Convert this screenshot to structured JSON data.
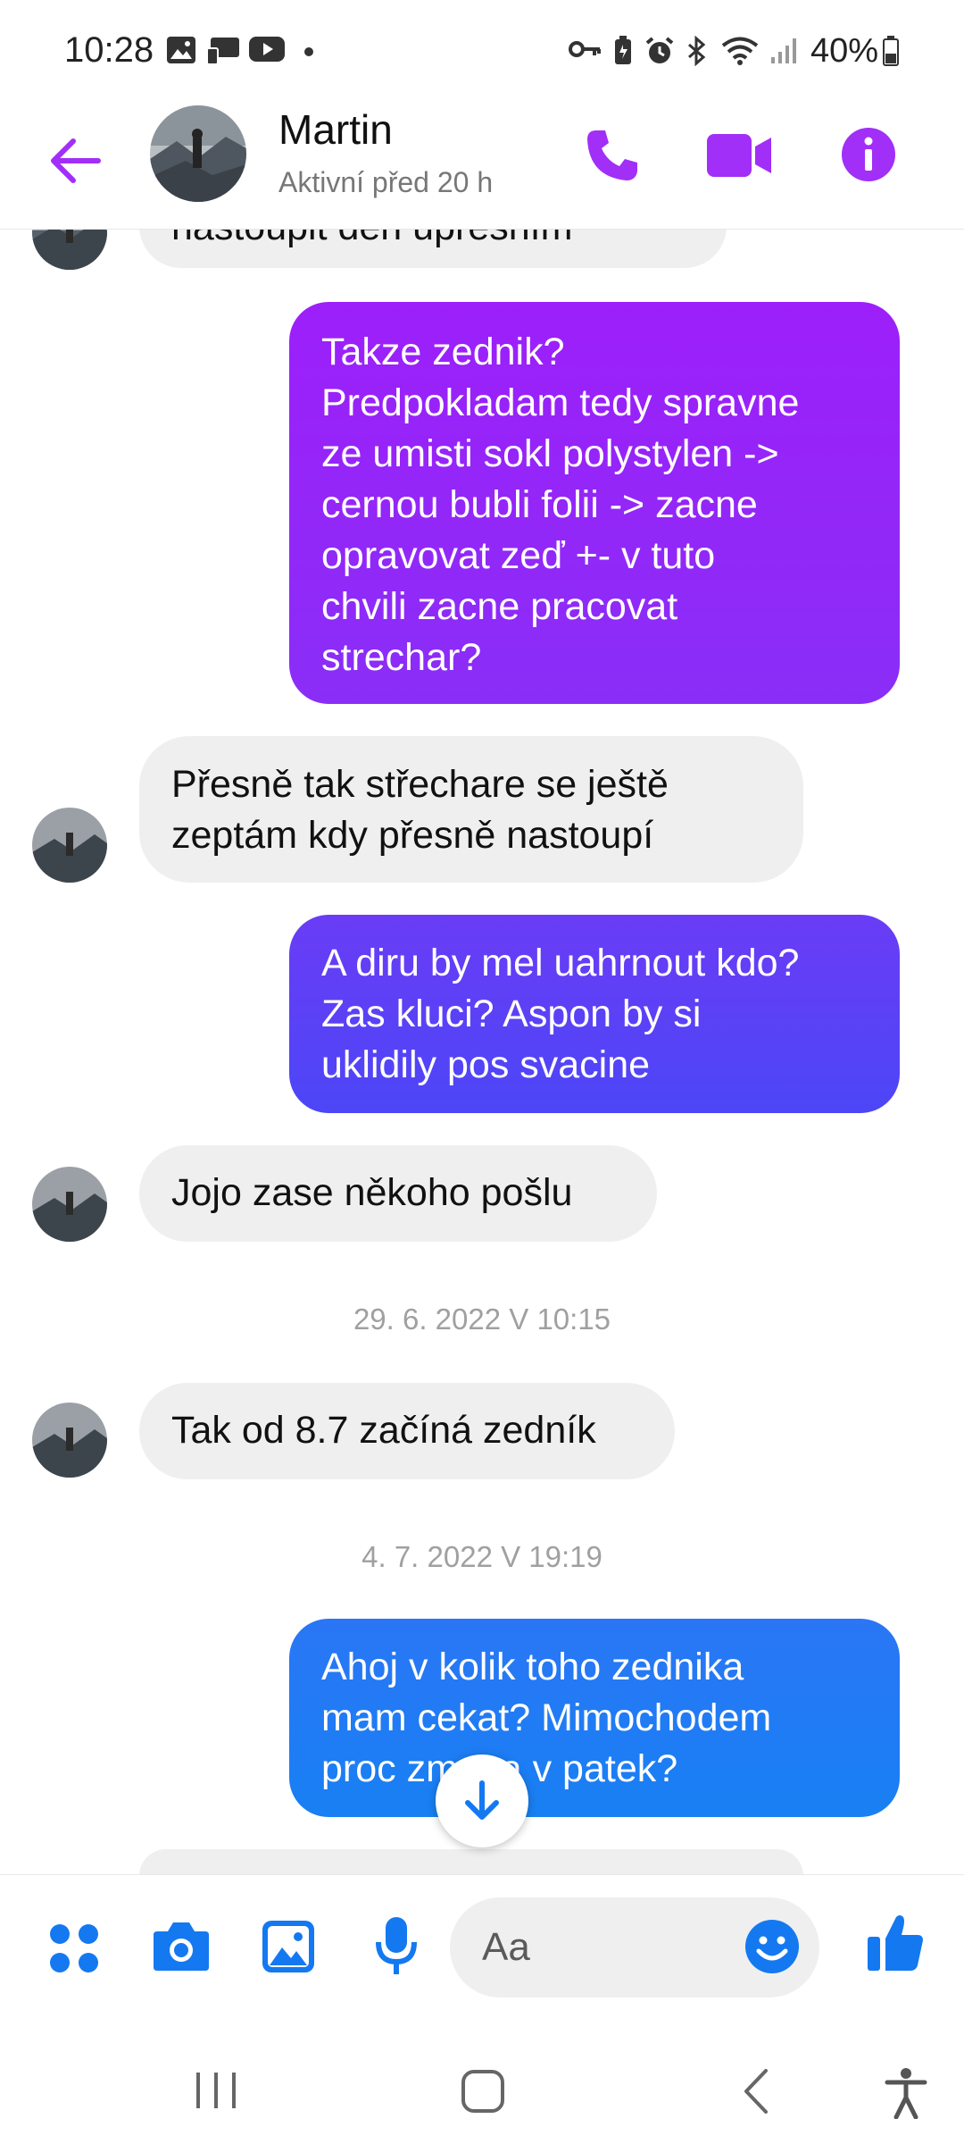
{
  "status_bar": {
    "time": "10:28",
    "battery": "40%",
    "icons_left": [
      "gallery-icon",
      "cast-icon",
      "youtube-icon",
      "dot-icon"
    ],
    "icons_right": [
      "key-icon",
      "battery-saver-icon",
      "alarm-icon",
      "bluetooth-icon",
      "wifi-icon",
      "signal-icon",
      "battery-icon"
    ]
  },
  "header": {
    "contact_name": "Martin",
    "contact_status": "Aktivní před 20 h",
    "back_icon": "arrow-left-icon",
    "call_icon": "phone-icon",
    "video_icon": "video-icon",
    "info_icon": "info-icon"
  },
  "messages": {
    "m0": {
      "text": "nastoupit den upřesním",
      "from": "contact"
    },
    "m1": {
      "lines": [
        "Takze zednik?",
        "Predpokladam tedy spravne",
        "ze umisti sokl polystylen ->",
        "cernou bubli folii -> zacne",
        "opravovat zeď +- v tuto",
        "chvili zacne pracovat",
        "strechar?"
      ],
      "from": "me"
    },
    "m2": {
      "lines": [
        "Přesně tak střechare se ještě",
        "zeptám kdy přesně nastoupí"
      ],
      "from": "contact"
    },
    "m3": {
      "lines": [
        "A diru by mel uahrnout kdo?",
        "Zas kluci? Aspon by si",
        "uklidily pos svacine"
      ],
      "from": "me"
    },
    "m4": {
      "text": "Jojo zase někoho pošlu",
      "from": "contact"
    },
    "ts1": "29. 6. 2022 V 10:15",
    "m5": {
      "text": "Tak od 8.7 začíná zedník",
      "from": "contact"
    },
    "ts2": "4. 7. 2022 V 19:19",
    "m6": {
      "lines": [
        "Ahoj v kolik toho zednika",
        "mam cekat? Mimochodem",
        "proc zmena v patek?"
      ],
      "from": "me"
    }
  },
  "composer": {
    "placeholder": "Aa",
    "icons": [
      "menu-dots-icon",
      "camera-icon",
      "image-icon",
      "microphone-icon",
      "emoji-icon",
      "thumbs-up-icon"
    ],
    "scroll_down_icon": "arrow-down-icon"
  },
  "nav_bar": {
    "icons": [
      "recent-apps-icon",
      "home-icon",
      "back-icon",
      "accessibility-icon"
    ]
  },
  "colors": {
    "accent_purple": "#a12ff7",
    "bubble_purple": "#9b20f8",
    "bubble_violet": "#5d3ff6",
    "bubble_blue": "#1e7bf4",
    "composer_blue": "#1479f0",
    "incoming_bubble": "#efefef"
  }
}
